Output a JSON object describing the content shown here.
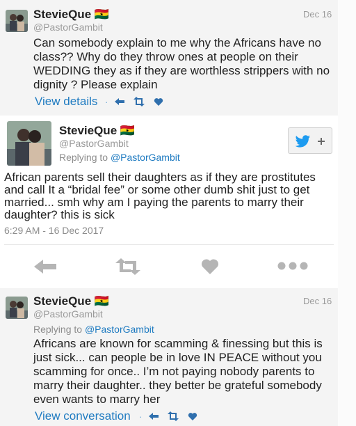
{
  "tweets": [
    {
      "name": "StevieQue 🇬🇭",
      "handle": "@PastorGambit",
      "date": "Dec 16",
      "text": "Can somebody explain to me why the Africans have no class?? Why do they throw ones at people on their WEDDING they as if they are worthless strippers with no dignity ? Please explain",
      "link": "View details"
    },
    {
      "name": "StevieQue 🇬🇭",
      "handle": "@PastorGambit",
      "replying_prefix": "Replying to ",
      "replying_user": "@PastorGambit",
      "text": "African parents sell their daughters as if they are prostitutes and call It a “bridal fee” or some other dumb shit just to get married... smh why am I paying the parents to marry their daughter? this is sick",
      "timestamp": "6:29 AM - 16 Dec 2017"
    },
    {
      "name": "StevieQue 🇬🇭",
      "handle": "@PastorGambit",
      "date": "Dec 16",
      "replying_prefix": "Replying to ",
      "replying_user": "@PastorGambit",
      "text": "Africans are known for scamming & finessing but this is just sick... can people be in love IN PEACE without you scamming for once.. I’m not paying nobody parents to marry their daughter.. they better be grateful somebody even wants to marry her",
      "link": "View conversation"
    }
  ],
  "separator": "·",
  "icons": {
    "reply": "reply-icon",
    "retweet": "retweet-icon",
    "like": "heart-icon",
    "more": "more-icon",
    "follow": "twitter-follow-icon"
  },
  "colors": {
    "link": "#1f7bc1",
    "icon_small": "#2f6fad",
    "icon_large": "#b5b5b5",
    "twitter_blue": "#1d9bf0"
  }
}
